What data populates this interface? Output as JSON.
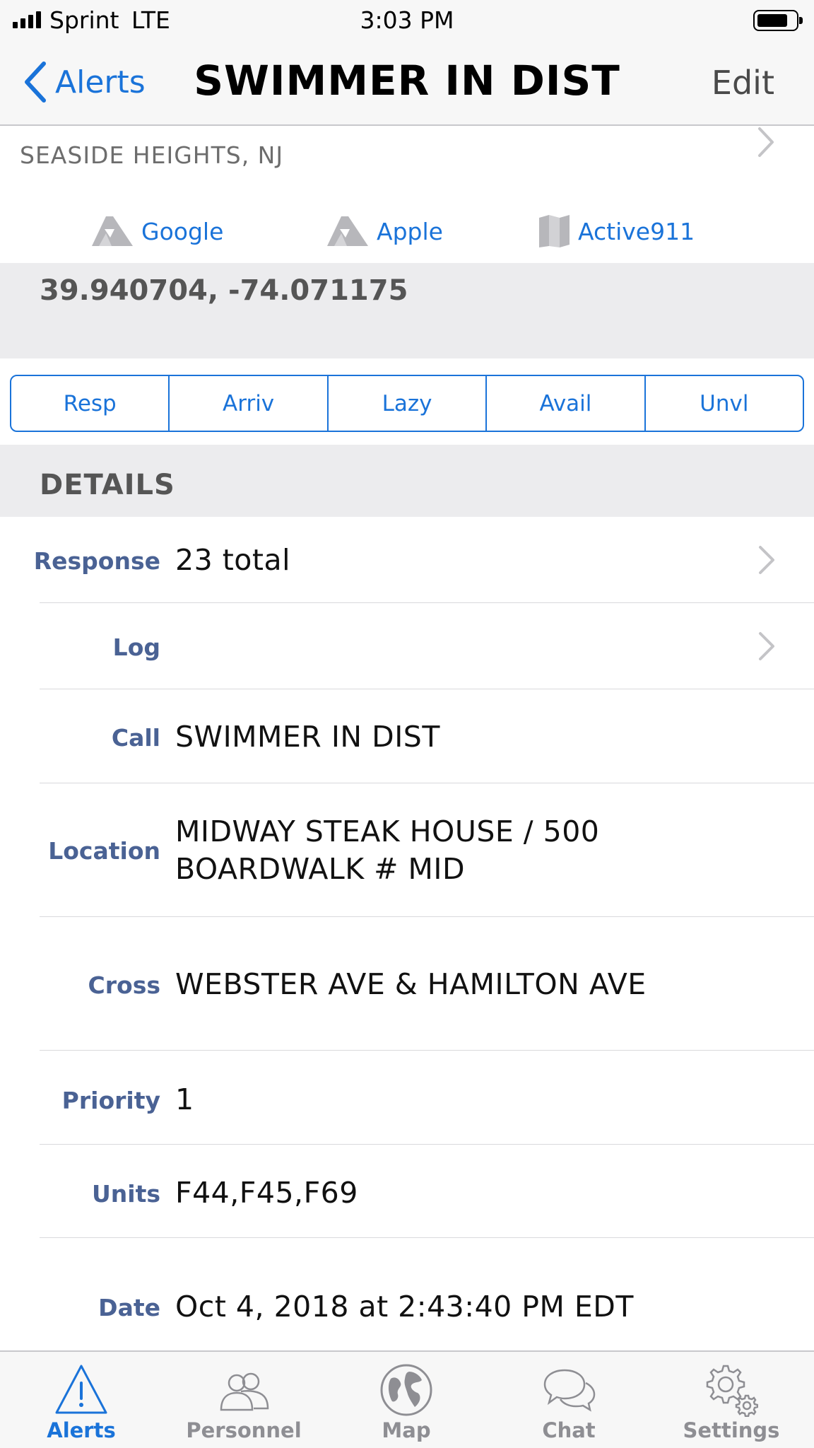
{
  "status_bar": {
    "carrier": "Sprint",
    "network": "LTE",
    "time": "3:03 PM"
  },
  "nav": {
    "back_label": "Alerts",
    "title": "SWIMMER IN DIST",
    "edit_label": "Edit"
  },
  "location": {
    "city": "SEASIDE HEIGHTS, NJ",
    "map_links": [
      {
        "label": "Google",
        "icon": "map-fold-icon"
      },
      {
        "label": "Apple",
        "icon": "map-fold-icon"
      },
      {
        "label": "Active911",
        "icon": "map-icon"
      }
    ],
    "coordinates": "39.940704, -74.071175"
  },
  "response_buttons": [
    "Resp",
    "Arriv",
    "Lazy",
    "Avail",
    "Unvl"
  ],
  "details": {
    "header": "DETAILS",
    "rows": [
      {
        "label": "Response",
        "value": "23 total"
      },
      {
        "label": "Log",
        "value": ""
      },
      {
        "label": "Call",
        "value": "SWIMMER IN DIST"
      },
      {
        "label": "Location",
        "value": "MIDWAY STEAK HOUSE / 500 BOARDWALK # MID"
      },
      {
        "label": "Cross",
        "value": "WEBSTER AVE & HAMILTON AVE"
      },
      {
        "label": "Priority",
        "value": "1"
      },
      {
        "label": "Units",
        "value": "F44,F45,F69"
      },
      {
        "label": "Date",
        "value": "Oct 4, 2018 at 2:43:40 PM EDT"
      }
    ]
  },
  "tab_bar": {
    "tabs": [
      {
        "label": "Alerts",
        "icon": "alert-triangle-icon",
        "active": true
      },
      {
        "label": "Personnel",
        "icon": "people-icon",
        "active": false
      },
      {
        "label": "Map",
        "icon": "globe-icon",
        "active": false
      },
      {
        "label": "Chat",
        "icon": "chat-bubbles-icon",
        "active": false
      },
      {
        "label": "Settings",
        "icon": "gear-icon",
        "active": false
      }
    ]
  },
  "colors": {
    "accent": "#1a73d9",
    "label": "#4a6294",
    "section_bg": "#ececee",
    "inactive_tab": "#8e8e93"
  }
}
